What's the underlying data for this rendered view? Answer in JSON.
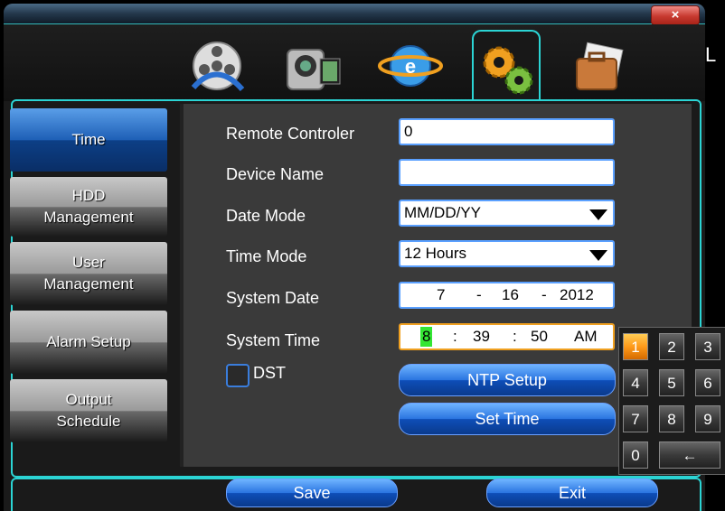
{
  "window": {
    "close_label": "×"
  },
  "top_icons": [
    {
      "name": "video-reel-icon"
    },
    {
      "name": "camera-icon"
    },
    {
      "name": "network-icon"
    },
    {
      "name": "settings-gears-icon",
      "active": true
    },
    {
      "name": "briefcase-icon"
    }
  ],
  "sidebar": {
    "items": [
      {
        "label1": "Time",
        "label2": "",
        "active": true
      },
      {
        "label1": "HDD",
        "label2": "Management"
      },
      {
        "label1": "User",
        "label2": "Management"
      },
      {
        "label1": "Alarm Setup",
        "label2": ""
      },
      {
        "label1": "Output",
        "label2": "Schedule"
      }
    ]
  },
  "form": {
    "remote_controller": {
      "label": "Remote Controler",
      "value": "0"
    },
    "device_name": {
      "label": "Device Name",
      "value": ""
    },
    "date_mode": {
      "label": "Date Mode",
      "value": "MM/DD/YY"
    },
    "time_mode": {
      "label": "Time Mode",
      "value": "12 Hours"
    },
    "system_date": {
      "label": "System Date",
      "month": "7",
      "sep1": "-",
      "day": "16",
      "sep2": "-",
      "year": "2012"
    },
    "system_time": {
      "label": "System Time",
      "hour": "8",
      "sep1": ":",
      "minute": "39",
      "sep2": ":",
      "second": "50",
      "ampm": "AM"
    },
    "dst": {
      "label": "DST",
      "checked": false
    },
    "ntp_button": "NTP Setup",
    "set_time_button": "Set Time"
  },
  "numpad": {
    "keys": [
      "1",
      "2",
      "3",
      "4",
      "5",
      "6",
      "7",
      "8",
      "9",
      "0",
      "←"
    ],
    "active": "1"
  },
  "bottom": {
    "save_label": "Save",
    "exit_label": "Exit"
  },
  "edge_text": "L",
  "colors": {
    "accent": "#2bd4d4",
    "button": "#1e5fb6",
    "highlight": "#ff9a1a"
  }
}
